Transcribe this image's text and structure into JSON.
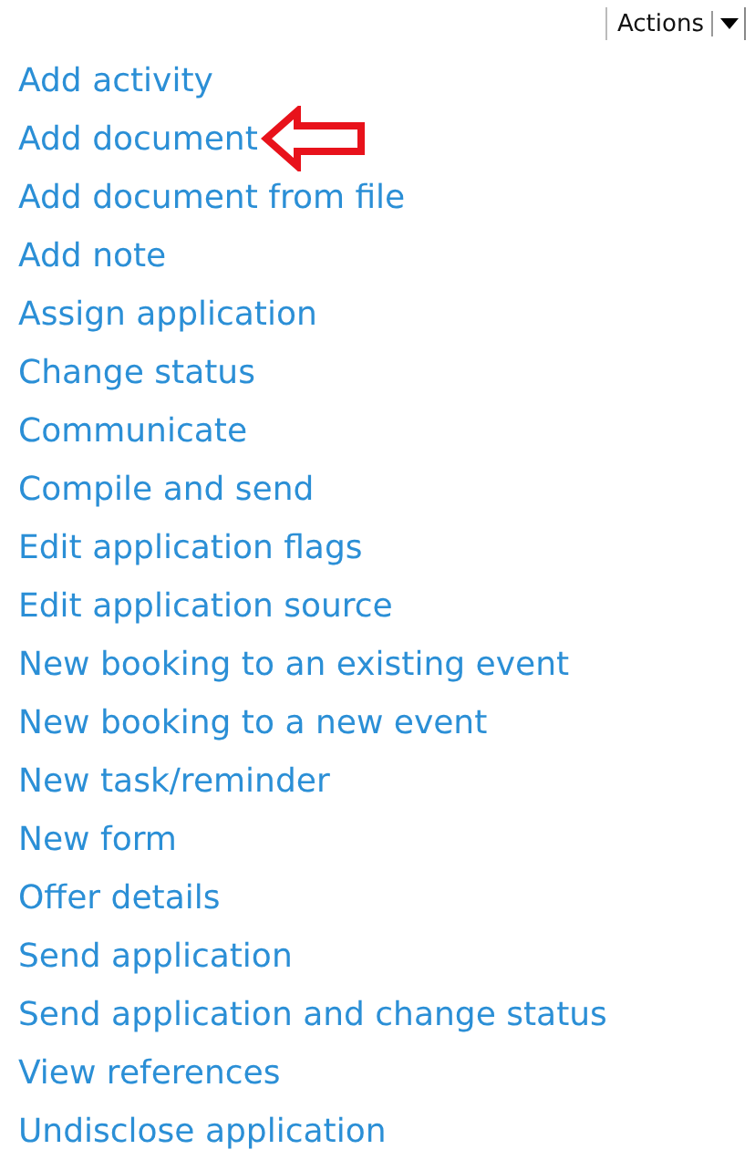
{
  "actions_menu": {
    "label": "Actions"
  },
  "items": [
    {
      "label": "Add activity",
      "marked": false
    },
    {
      "label": "Add document",
      "marked": true
    },
    {
      "label": "Add document from file",
      "marked": false
    },
    {
      "label": "Add note",
      "marked": false
    },
    {
      "label": "Assign application",
      "marked": false
    },
    {
      "label": "Change status",
      "marked": false
    },
    {
      "label": "Communicate",
      "marked": false
    },
    {
      "label": "Compile and send",
      "marked": false
    },
    {
      "label": "Edit application flags",
      "marked": false
    },
    {
      "label": "Edit application source",
      "marked": false
    },
    {
      "label": "New booking to an existing event",
      "marked": false
    },
    {
      "label": "New booking to a new event",
      "marked": false
    },
    {
      "label": "New task/reminder",
      "marked": false
    },
    {
      "label": "New form",
      "marked": false
    },
    {
      "label": "Offer details",
      "marked": false
    },
    {
      "label": "Send application",
      "marked": false
    },
    {
      "label": "Send application and change status",
      "marked": false
    },
    {
      "label": "View references",
      "marked": false
    },
    {
      "label": "Undisclose application",
      "marked": false
    }
  ]
}
